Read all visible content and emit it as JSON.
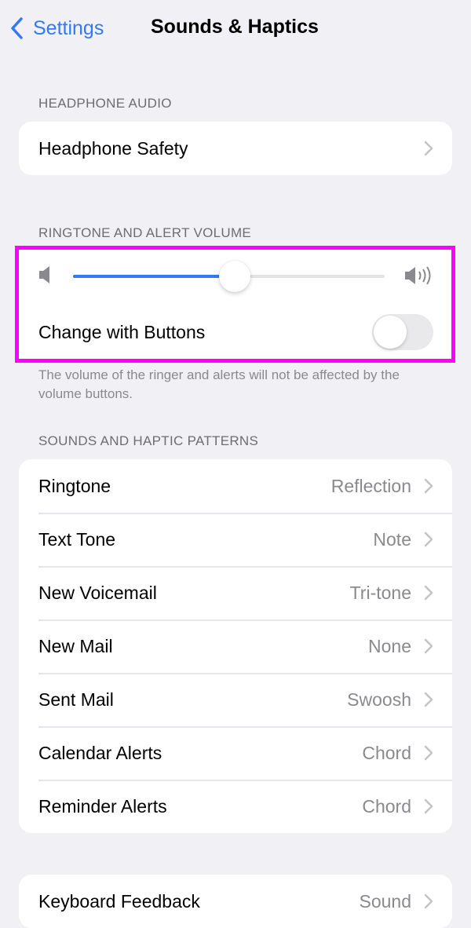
{
  "nav": {
    "back_label": "Settings",
    "title": "Sounds & Haptics"
  },
  "headphone_audio": {
    "header": "HEADPHONE AUDIO",
    "items": [
      {
        "label": "Headphone Safety"
      }
    ]
  },
  "ringtone_volume": {
    "header": "RINGTONE AND ALERT VOLUME",
    "volume_fraction": 0.52,
    "change_with_buttons": {
      "label": "Change with Buttons",
      "enabled": false
    },
    "footer": "The volume of the ringer and alerts will not be affected by the volume buttons."
  },
  "sounds_patterns": {
    "header": "SOUNDS AND HAPTIC PATTERNS",
    "items": [
      {
        "label": "Ringtone",
        "value": "Reflection"
      },
      {
        "label": "Text Tone",
        "value": "Note"
      },
      {
        "label": "New Voicemail",
        "value": "Tri-tone"
      },
      {
        "label": "New Mail",
        "value": "None"
      },
      {
        "label": "Sent Mail",
        "value": "Swoosh"
      },
      {
        "label": "Calendar Alerts",
        "value": "Chord"
      },
      {
        "label": "Reminder Alerts",
        "value": "Chord"
      }
    ]
  },
  "feedback": {
    "items": [
      {
        "label": "Keyboard Feedback",
        "value": "Sound"
      }
    ]
  },
  "colors": {
    "accent": "#3478f6",
    "highlight": "#ff00ff",
    "background": "#f0f0f5"
  }
}
